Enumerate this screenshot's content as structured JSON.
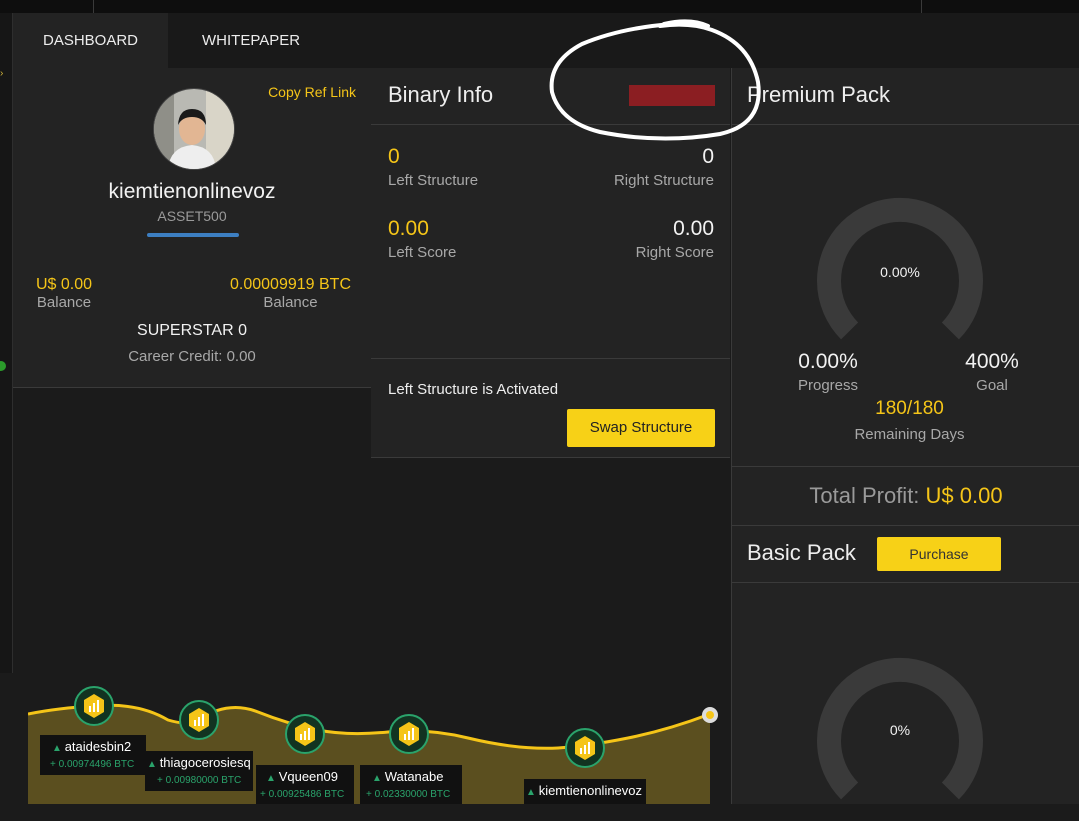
{
  "nav": {
    "tabs": [
      {
        "label": "DASHBOARD"
      },
      {
        "label": "WHITEPAPER"
      }
    ]
  },
  "profile": {
    "copy_link": "Copy Ref Link",
    "username": "kiemtienonlinevoz",
    "pack": "ASSET500",
    "balance_usd": {
      "amount": "U$ 0.00",
      "label": "Balance"
    },
    "balance_btc": {
      "amount": "0.00009919 BTC",
      "label": "Balance"
    },
    "rank": "SUPERSTAR 0",
    "career_credit": "Career Credit: 0.00"
  },
  "binary": {
    "title": "Binary Info",
    "left_structure": {
      "value": "0",
      "label": "Left Structure"
    },
    "right_structure": {
      "value": "0",
      "label": "Right Structure"
    },
    "left_score": {
      "value": "0.00",
      "label": "Left Score"
    },
    "right_score": {
      "value": "0.00",
      "label": "Right Score"
    },
    "status_text": "Left Structure is Activated",
    "swap_label": "Swap Structure",
    "badge_color": "#8b1e22"
  },
  "premium": {
    "title": "Premium Pack",
    "gauge_text": "0.00%",
    "gauge_fraction": 0,
    "progress": {
      "value": "0.00%",
      "label": "Progress"
    },
    "goal": {
      "value": "400%",
      "label": "Goal"
    },
    "remaining_days": {
      "value": "180/180",
      "label": "Remaining Days"
    },
    "total_profit_label": "Total Profit:",
    "total_profit_value": "U$ 0.00"
  },
  "basic": {
    "title": "Basic Pack",
    "purchase_label": "Purchase",
    "gauge_text": "0%",
    "gauge_fraction": 0
  },
  "ranking": {
    "users": [
      {
        "name": "ataidesbin2",
        "btc": "+ 0.00974496 BTC"
      },
      {
        "name": "thiagocerosiesq",
        "btc": "+ 0.00980000 BTC"
      },
      {
        "name": "Vqueen09",
        "btc": "+ 0.00925486 BTC"
      },
      {
        "name": "Watanabe",
        "btc": "+ 0.02330000 BTC"
      },
      {
        "name": "kiemtienonlinevoz",
        "btc": ""
      }
    ]
  },
  "colors": {
    "accent": "#f5c518",
    "background": "#1b1b1b",
    "card": "#232323"
  }
}
